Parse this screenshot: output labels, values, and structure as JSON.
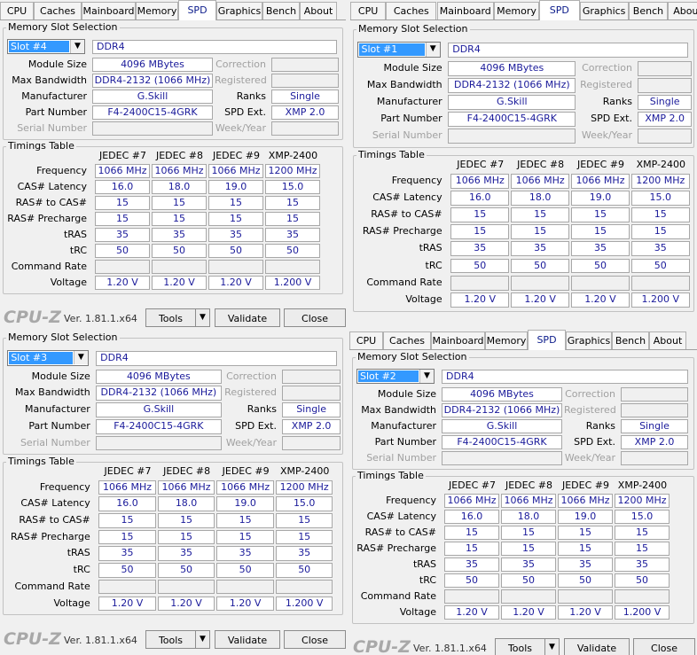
{
  "tabs": [
    "CPU",
    "Caches",
    "Mainboard",
    "Memory",
    "SPD",
    "Graphics",
    "Bench",
    "About"
  ],
  "active_tab": "SPD",
  "memory_slot_selection_title": "Memory Slot Selection",
  "timings_table_title": "Timings Table",
  "labels": {
    "module_size": "Module Size",
    "max_bandwidth": "Max Bandwidth",
    "manufacturer": "Manufacturer",
    "part_number": "Part Number",
    "serial_number": "Serial Number",
    "correction": "Correction",
    "registered": "Registered",
    "ranks": "Ranks",
    "spd_ext": "SPD Ext.",
    "week_year": "Week/Year"
  },
  "timing_columns": [
    "JEDEC #7",
    "JEDEC #8",
    "JEDEC #9",
    "XMP-2400"
  ],
  "timing_rows": [
    {
      "label": "Frequency",
      "values": [
        "1066 MHz",
        "1066 MHz",
        "1066 MHz",
        "1200 MHz"
      ]
    },
    {
      "label": "CAS# Latency",
      "values": [
        "16.0",
        "18.0",
        "19.0",
        "15.0"
      ]
    },
    {
      "label": "RAS# to CAS#",
      "values": [
        "15",
        "15",
        "15",
        "15"
      ]
    },
    {
      "label": "RAS# Precharge",
      "values": [
        "15",
        "15",
        "15",
        "15"
      ]
    },
    {
      "label": "tRAS",
      "values": [
        "35",
        "35",
        "35",
        "35"
      ]
    },
    {
      "label": "tRC",
      "values": [
        "50",
        "50",
        "50",
        "50"
      ]
    },
    {
      "label": "Command Rate",
      "values": [
        "",
        "",
        "",
        ""
      ]
    },
    {
      "label": "Voltage",
      "values": [
        "1.20 V",
        "1.20 V",
        "1.20 V",
        "1.200 V"
      ]
    }
  ],
  "footer": {
    "logo": "CPU-Z",
    "version": "Ver. 1.81.1.x64",
    "tools": "Tools",
    "validate": "Validate",
    "close": "Close"
  },
  "panels": [
    {
      "slot": "Slot #4",
      "memory_type": "DDR4",
      "module_size": "4096 MBytes",
      "max_bandwidth": "DDR4-2132 (1066 MHz)",
      "manufacturer": "G.Skill",
      "part_number": "F4-2400C15-4GRK",
      "ranks": "Single",
      "spd_ext": "XMP 2.0"
    },
    {
      "slot": "Slot #1",
      "memory_type": "DDR4",
      "module_size": "4096 MBytes",
      "max_bandwidth": "DDR4-2132 (1066 MHz)",
      "manufacturer": "G.Skill",
      "part_number": "F4-2400C15-4GRK",
      "ranks": "Single",
      "spd_ext": "XMP 2.0"
    },
    {
      "slot": "Slot #3",
      "memory_type": "DDR4",
      "module_size": "4096 MBytes",
      "max_bandwidth": "DDR4-2132 (1066 MHz)",
      "manufacturer": "G.Skill",
      "part_number": "F4-2400C15-4GRK",
      "ranks": "Single",
      "spd_ext": "XMP 2.0"
    },
    {
      "slot": "Slot #2",
      "memory_type": "DDR4",
      "module_size": "4096 MBytes",
      "max_bandwidth": "DDR4-2132 (1066 MHz)",
      "manufacturer": "G.Skill",
      "part_number": "F4-2400C15-4GRK",
      "ranks": "Single",
      "spd_ext": "XMP 2.0"
    }
  ]
}
